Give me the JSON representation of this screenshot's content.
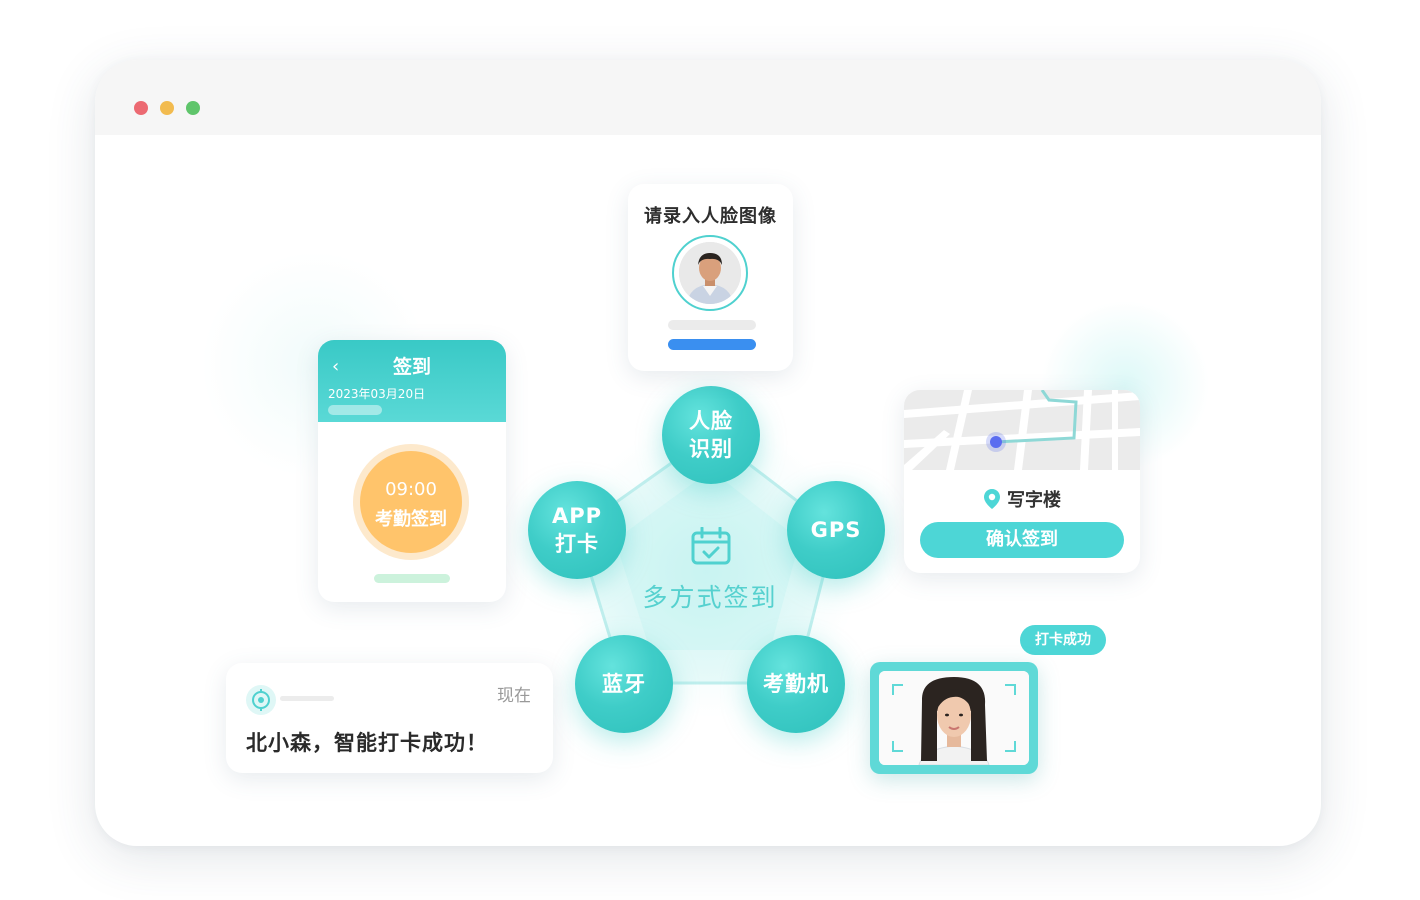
{
  "window": {
    "controls": [
      "close",
      "minimize",
      "maximize"
    ]
  },
  "face_enroll": {
    "title": "请录入人脸图像"
  },
  "sign_in": {
    "back_icon": "‹",
    "title": "签到",
    "date": "2023年03月20日",
    "clock_time": "09:00",
    "clock_label": "考勤签到"
  },
  "diagram": {
    "center_label": "多方式签到",
    "center_icon": "calendar-check-icon",
    "nodes": [
      {
        "line1": "人脸",
        "line2": "识别"
      },
      {
        "line1": "GPS",
        "line2": ""
      },
      {
        "line1": "考勤机",
        "line2": ""
      },
      {
        "line1": "蓝牙",
        "line2": ""
      },
      {
        "line1": "APP",
        "line2": "打卡"
      }
    ]
  },
  "map": {
    "location": "写字楼",
    "confirm_label": "确认签到"
  },
  "notification": {
    "time": "现在",
    "message": "北小森，智能打卡成功！"
  },
  "face_scan": {
    "badge": "打卡成功"
  },
  "colors": {
    "accent": "#4dd6d6",
    "node": "#3fcdc8",
    "blue": "#3a8ff0",
    "orange": "#ffc46b"
  }
}
